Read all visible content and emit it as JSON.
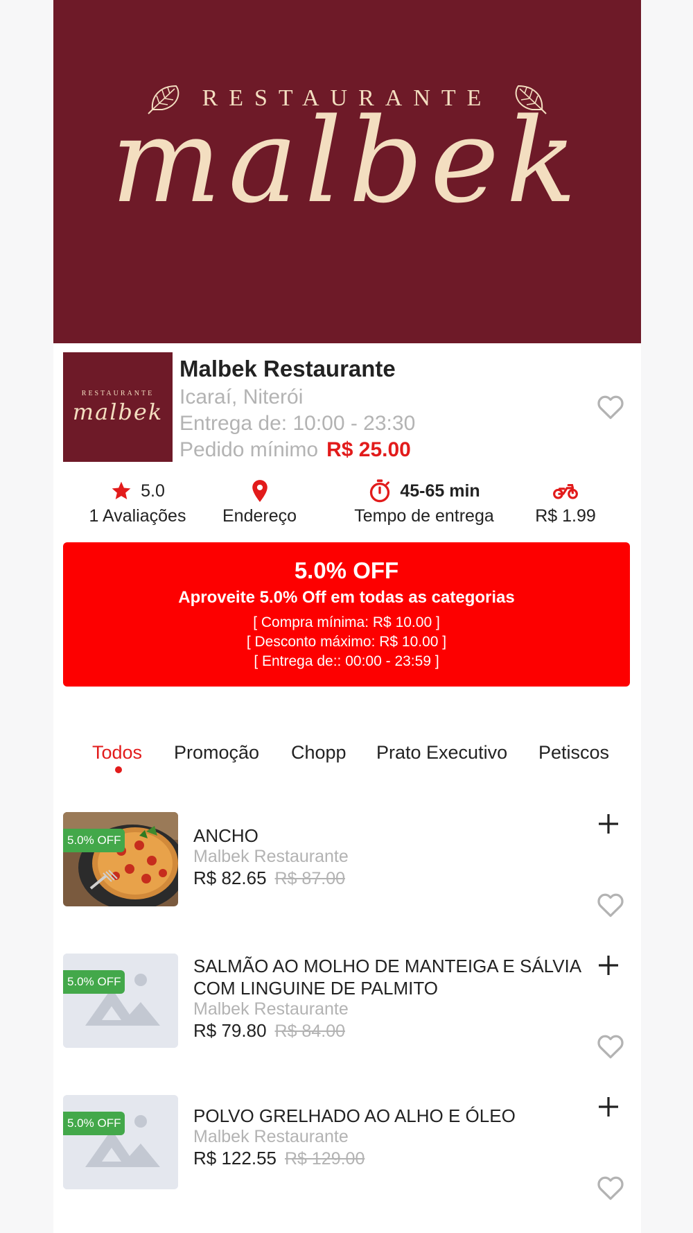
{
  "banner": {
    "top_word": "RESTAURANTE",
    "script_word": "malbek"
  },
  "restaurant": {
    "logo_top": "RESTAURANTE",
    "logo_script": "malbek",
    "name": "Malbek Restaurante",
    "location": "Icaraí, Niterói",
    "hours": "Entrega de: 10:00 - 23:30",
    "min_order_label": "Pedido mínimo",
    "min_order_value": "R$ 25.00"
  },
  "stats": {
    "rating_value": "5.0",
    "rating_label": "1 Avaliações",
    "address_label": "Endereço",
    "time_value": "45-65 min",
    "time_label": "Tempo de entrega",
    "fee_label": "R$ 1.99"
  },
  "promo": {
    "title": "5.0% OFF",
    "subtitle": "Aproveite 5.0% Off em todas as categorias",
    "line1": "[ Compra mínima: R$ 10.00 ]",
    "line2": "[ Desconto máximo: R$ 10.00 ]",
    "line3": "[ Entrega de:: 00:00 - 23:59 ]"
  },
  "tabs": [
    {
      "label": "Todos"
    },
    {
      "label": "Promoção"
    },
    {
      "label": "Chopp"
    },
    {
      "label": "Prato Executivo"
    },
    {
      "label": "Petiscos"
    }
  ],
  "products": [
    {
      "badge": "5.0% OFF",
      "name": "ANCHO",
      "store": "Malbek Restaurante",
      "price": "R$ 82.65",
      "old_price": "R$ 87.00"
    },
    {
      "badge": "5.0% OFF",
      "name": "SALMÃO AO MOLHO DE MANTEIGA E SÁLVIA COM LINGUINE DE PALMITO",
      "store": "Malbek Restaurante",
      "price": "R$ 79.80",
      "old_price": "R$ 84.00"
    },
    {
      "badge": "5.0% OFF",
      "name": "POLVO GRELHADO AO ALHO E ÓLEO",
      "store": "Malbek Restaurante",
      "price": "R$ 122.55",
      "old_price": "R$ 129.00"
    }
  ],
  "colors": {
    "brand": "#6e1a28",
    "accent": "#e21b1b",
    "promo": "#fd0000",
    "badge": "#43a84a"
  }
}
